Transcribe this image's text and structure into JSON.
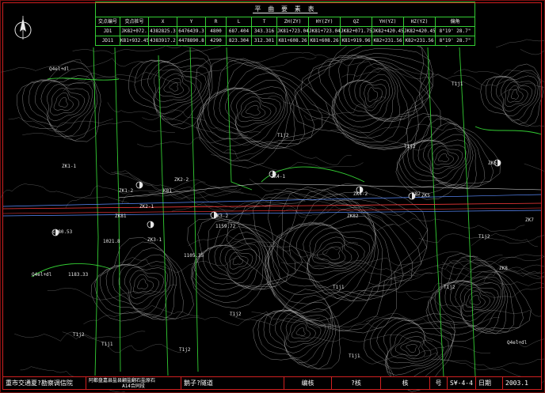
{
  "curve_table": {
    "title": "平 曲 要 素 表",
    "headers": [
      "交点编号",
      "交点桩号",
      "X",
      "Y",
      "R",
      "L",
      "T",
      "ZH(ZY)",
      "HY(ZY)",
      "QZ",
      "YH(YZ)",
      "HZ(YZ)",
      "偏角"
    ],
    "rows": [
      [
        "JD1",
        "JK82+072.",
        "4382825.3",
        "6476439.3",
        "4800",
        "687.404",
        "343.316",
        "JK81+723.04",
        "JK81+723.04",
        "JK82+071.75",
        "JK82+420.45",
        "JK82+420.45",
        "8°19' 28.7\""
      ],
      [
        "JD11",
        "K81+932.45",
        "4383917.2",
        "4478890.8",
        "4290",
        "823.304",
        "312.301",
        "K81+608.26",
        "K81+608.26",
        "K81+919.96",
        "K82+231.56",
        "K82+231.56",
        "8°19' 28.7\""
      ]
    ]
  },
  "title_block": {
    "institute": "重市交通夏?勘察调信院",
    "project_line1": "阿都盘嘉县盐县翩盐翻石盐原石",
    "project_line2": "A14合同段",
    "drawing_name": "鹅子?隧道",
    "role1": "编核",
    "role2": "?核",
    "role3": "核",
    "number_label": "号",
    "drawing_no": "S¥-4-4",
    "date_label": "日期",
    "date": "2003.1"
  },
  "map_labels": [
    {
      "text": "ZK81",
      "color": "#e6e6e6"
    },
    {
      "text": "K81",
      "color": "#e6e6e6"
    },
    {
      "text": "ZK82",
      "color": "#e6e6e6"
    },
    {
      "text": "K82",
      "color": "#e6e6e6"
    },
    {
      "text": "Q4el+dl",
      "color": "#e6e6e6"
    },
    {
      "text": "Q4el+dl",
      "color": "#e6e6e6"
    },
    {
      "text": "T1j2",
      "color": "#e6e6e6"
    },
    {
      "text": "T1j2",
      "color": "#e6e6e6"
    },
    {
      "text": "T1j1",
      "color": "#e6e6e6"
    },
    {
      "text": "T1j1",
      "color": "#e6e6e6"
    },
    {
      "text": "T1j2",
      "color": "#e6e6e6"
    },
    {
      "text": "T1j2",
      "color": "#e6e6e6"
    },
    {
      "text": "T1j2",
      "color": "#e6e6e6"
    },
    {
      "text": "T1j1",
      "color": "#e6e6e6"
    },
    {
      "text": "T1j1",
      "color": "#e6e6e6"
    },
    {
      "text": "T1j2",
      "color": "#e6e6e6"
    },
    {
      "text": "T1j1",
      "color": "#e6e6e6"
    },
    {
      "text": "ZK1-1",
      "color": "#e6e6e6"
    },
    {
      "text": "ZK1-2",
      "color": "#e6e6e6"
    },
    {
      "text": "ZK2-1",
      "color": "#e6e6e6"
    },
    {
      "text": "ZK2-2",
      "color": "#e6e6e6"
    },
    {
      "text": "ZK3-1",
      "color": "#e6e6e6"
    },
    {
      "text": "ZK3-2",
      "color": "#e6e6e6"
    },
    {
      "text": "ZK4-1",
      "color": "#e6e6e6"
    },
    {
      "text": "ZK4-2",
      "color": "#e6e6e6"
    },
    {
      "text": "ZK5",
      "color": "#e6e6e6"
    },
    {
      "text": "ZK6",
      "color": "#e6e6e6"
    },
    {
      "text": "ZK7",
      "color": "#e6e6e6"
    },
    {
      "text": "ZK8",
      "color": "#e6e6e6"
    },
    {
      "text": "1080.53",
      "color": "#e6e6e6"
    },
    {
      "text": "1183.33",
      "color": "#e6e6e6"
    },
    {
      "text": "1021.8",
      "color": "#e6e6e6"
    },
    {
      "text": "1105.35",
      "color": "#e6e6e6"
    },
    {
      "text": "1159.72",
      "color": "#e6e6e6"
    },
    {
      "text": "Q4el+dl",
      "color": "#e6e6e6"
    },
    {
      "text": "T1j2",
      "color": "#e6e6e6"
    }
  ],
  "colors": {
    "background": "#000000",
    "contour": "#bfbfbf",
    "geology_line": "#33cc33",
    "road_centerline": "#ff3b3b",
    "tunnel_outline": "#5a8cff",
    "frame": "#d02020",
    "text": "#e6e6e6"
  },
  "icons": [
    "north-arrow-icon",
    "borehole-symbol-icon"
  ]
}
